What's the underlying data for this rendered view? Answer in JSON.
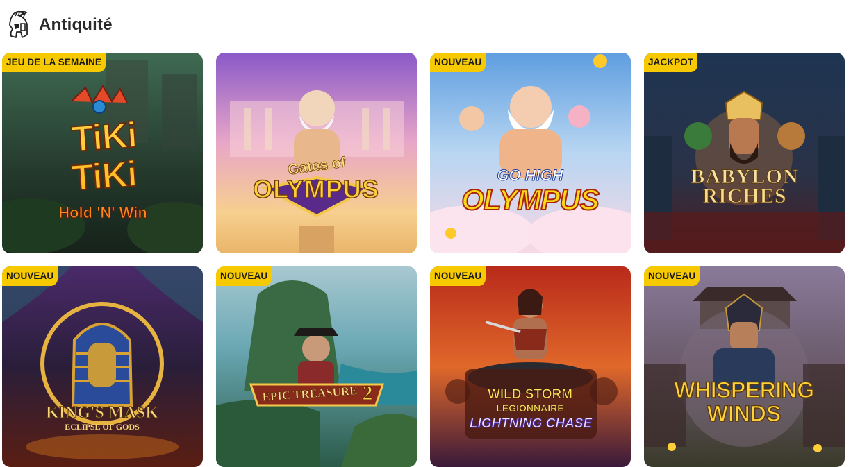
{
  "section": {
    "title": "Antiquité",
    "icon": "spartan-helmet-icon"
  },
  "games": [
    {
      "badge": "JEU DE LA SEMAINE",
      "logo_lines": [
        "TiKi",
        "TiKi",
        "Hold 'N' Win"
      ],
      "colors": {
        "bg1": "#2c4a3a",
        "bg2": "#1a2a22",
        "accent": "#f2a21a"
      }
    },
    {
      "badge": "",
      "logo_lines": [
        "Gates of",
        "OLYMPUS"
      ],
      "colors": {
        "bg1": "#d98fd0",
        "bg2": "#f4c98a",
        "accent": "#f5c64a"
      }
    },
    {
      "badge": "NOUVEAU",
      "logo_lines": [
        "GO HIGH",
        "OLYMPUS"
      ],
      "colors": {
        "bg1": "#7fb6e8",
        "bg2": "#f4d7e4",
        "accent": "#ffd21a"
      }
    },
    {
      "badge": "JACKPOT",
      "logo_lines": [
        "BABYLON",
        "RICHES"
      ],
      "colors": {
        "bg1": "#243a58",
        "bg2": "#341a20",
        "accent": "#f4c84a"
      }
    },
    {
      "badge": "NOUVEAU",
      "logo_lines": [
        "KING'S MASK",
        "ECLIPSE OF GODS"
      ],
      "colors": {
        "bg1": "#2a1e4a",
        "bg2": "#6a2a1a",
        "accent": "#e6b341"
      }
    },
    {
      "badge": "NOUVEAU",
      "logo_lines": [
        "EPIC TREASURE",
        "2"
      ],
      "colors": {
        "bg1": "#7bb8c4",
        "bg2": "#2a5a4a",
        "accent": "#f4c84a"
      }
    },
    {
      "badge": "NOUVEAU",
      "logo_lines": [
        "WILD STORM",
        "LEGIONNAIRE",
        "LIGHTNING CHASE"
      ],
      "colors": {
        "bg1": "#c8441a",
        "bg2": "#3a1a3a",
        "accent": "#ffd43a"
      }
    },
    {
      "badge": "NOUVEAU",
      "logo_lines": [
        "WHISPERING",
        "WINDS"
      ],
      "colors": {
        "bg1": "#7a6a8a",
        "bg2": "#3a3a2a",
        "accent": "#f6c23a"
      }
    }
  ]
}
